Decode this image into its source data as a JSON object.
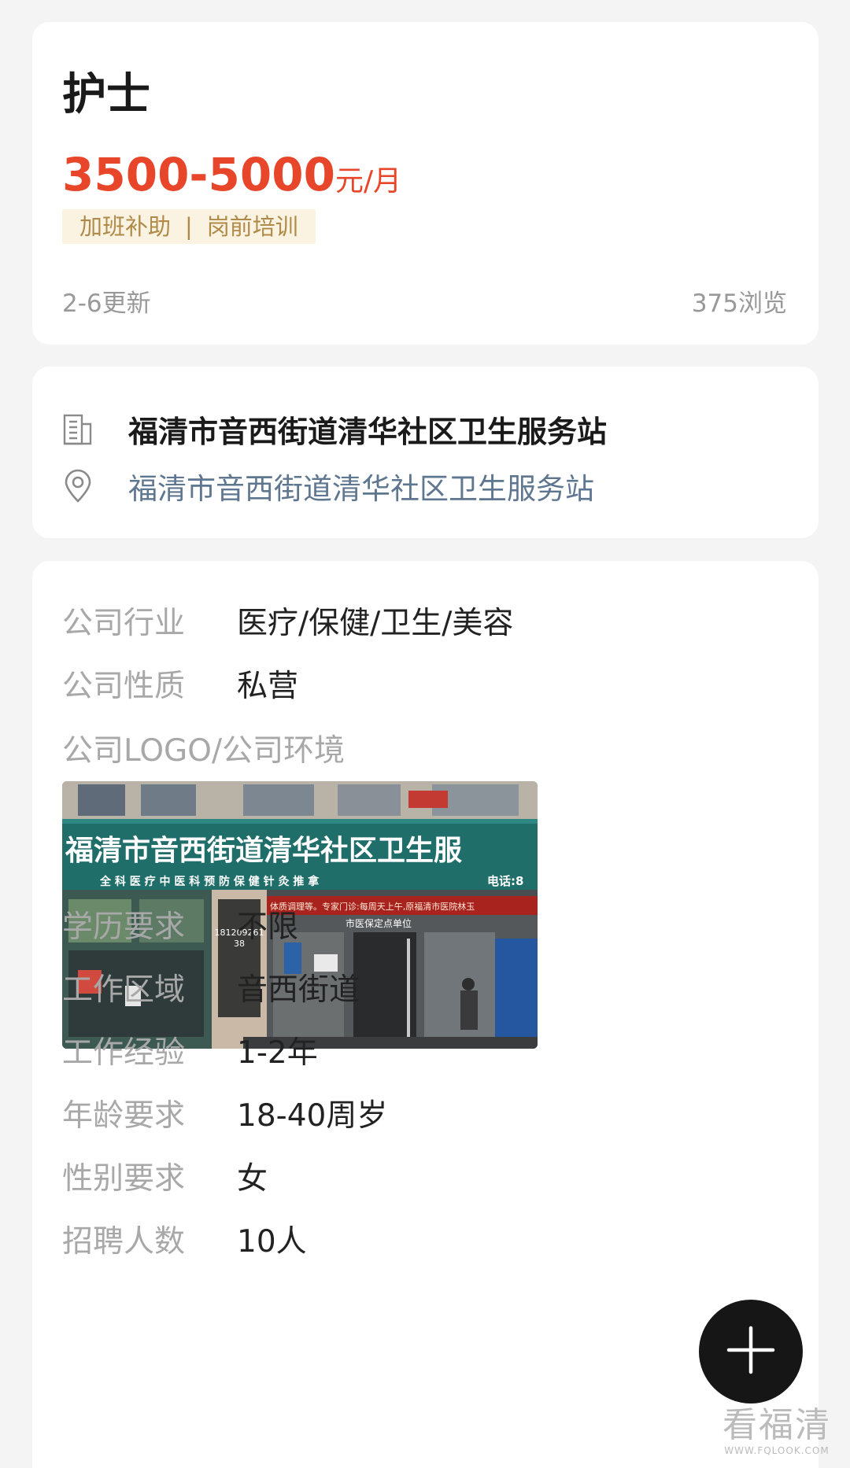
{
  "job": {
    "title": "护士",
    "salary": "3500-5000",
    "salary_unit": "元/月",
    "tags": [
      "加班补助",
      "岗前培训"
    ],
    "tag_separator": "|",
    "updated": "2-6更新",
    "views": "375浏览"
  },
  "company": {
    "name": "福清市音西街道清华社区卫生服务站",
    "address": "福清市音西街道清华社区卫生服务站",
    "icons": {
      "company": "building-icon",
      "address": "location-pin-icon"
    }
  },
  "details": {
    "industry": {
      "label": "公司行业",
      "value": "医疗/保健/卫生/美容"
    },
    "nature": {
      "label": "公司性质",
      "value": "私营"
    },
    "photo_label": "公司LOGO/公司环境",
    "photo": {
      "sign_main": "福清市音西街道清华社区卫生服",
      "sign_sub": "全 科 医 疗    中 医 科    预 防 保 健    针 灸 推 拿",
      "sign_phone": "电话:8",
      "banner": "体质调理等。专家门诊:每周天上午,原福清市医院林玉",
      "door_sign": "市医保定点单位",
      "window_phone_1": "181209261",
      "window_phone_2": "38"
    },
    "education": {
      "label": "学历要求",
      "value": "不限"
    },
    "area": {
      "label": "工作区域",
      "value": "音西街道"
    },
    "experience": {
      "label": "工作经验",
      "value": "1-2年"
    },
    "age": {
      "label": "年龄要求",
      "value": "18-40周岁"
    },
    "gender": {
      "label": "性别要求",
      "value": "女"
    },
    "headcount": {
      "label": "招聘人数",
      "value": "10人"
    }
  },
  "fab": {
    "icon": "plus-icon"
  },
  "watermark": {
    "main": "看福清",
    "sub": "WWW.FQLOOK.COM"
  },
  "colors": {
    "accent": "#e8462a",
    "tag_bg": "#fbf3e1",
    "tag_text": "#b08a48",
    "address": "#5f7690"
  }
}
